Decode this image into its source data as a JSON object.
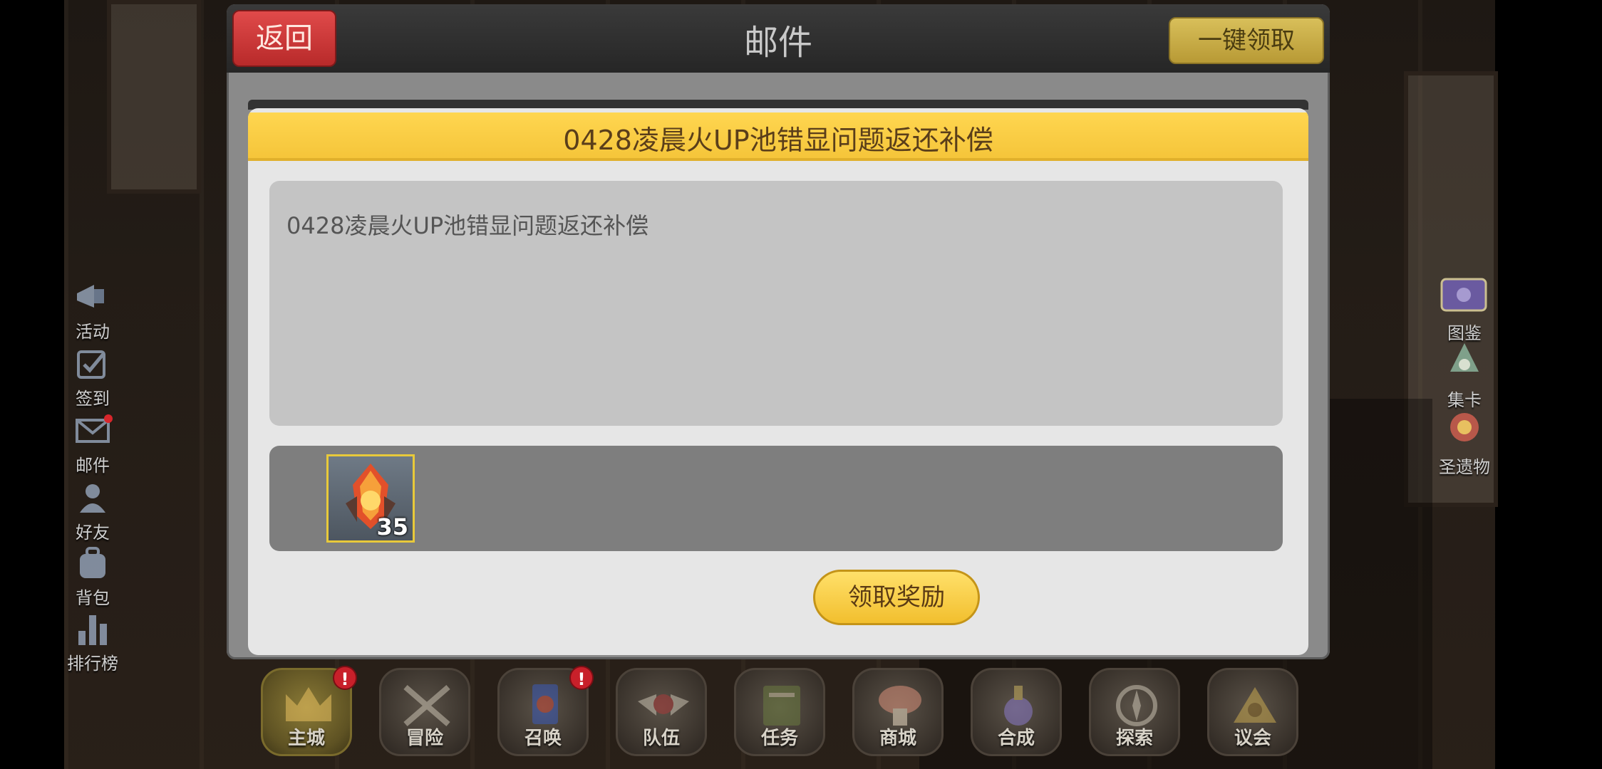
{
  "modal": {
    "back_label": "返回",
    "title": "邮件",
    "claim_all_label": "一键领取",
    "mail": {
      "subject": "0428凌晨火UP池错显问题返还补偿",
      "body": "0428凌晨火UP池错显问题返还补偿",
      "attachments": [
        {
          "icon": "fire-crystal-icon",
          "quantity": "35"
        }
      ],
      "claim_label": "领取奖励"
    }
  },
  "left_menu": {
    "items": [
      {
        "label": "活动",
        "icon": "megaphone-icon"
      },
      {
        "label": "签到",
        "icon": "checkin-icon"
      },
      {
        "label": "邮件",
        "icon": "mail-icon",
        "has_dot": true
      },
      {
        "label": "好友",
        "icon": "friends-icon"
      },
      {
        "label": "背包",
        "icon": "backpack-icon"
      },
      {
        "label": "排行榜",
        "icon": "leaderboard-icon"
      }
    ]
  },
  "right_menu": {
    "items": [
      {
        "label": "图鉴",
        "icon": "book-icon"
      },
      {
        "label": "集卡",
        "icon": "card-collection-icon"
      },
      {
        "label": "圣遗物",
        "icon": "relic-icon"
      }
    ]
  },
  "bottom_nav": {
    "items": [
      {
        "label": "主城",
        "icon": "crown-icon",
        "badge": "!"
      },
      {
        "label": "冒险",
        "icon": "crossed-weapons-icon"
      },
      {
        "label": "召唤",
        "icon": "summon-card-icon",
        "badge": "!"
      },
      {
        "label": "队伍",
        "icon": "winged-helmet-icon"
      },
      {
        "label": "任务",
        "icon": "quest-book-icon"
      },
      {
        "label": "商城",
        "icon": "mushroom-shop-icon"
      },
      {
        "label": "合成",
        "icon": "potion-icon"
      },
      {
        "label": "探索",
        "icon": "compass-icon"
      },
      {
        "label": "议会",
        "icon": "council-icon"
      }
    ]
  },
  "colors": {
    "back_button": "#d03a3a",
    "claim_all_button": "#c8ad48",
    "mail_title_bar": "#f7c843",
    "claim_button": "#f7cc3c",
    "item_border": "#e8c93a"
  }
}
